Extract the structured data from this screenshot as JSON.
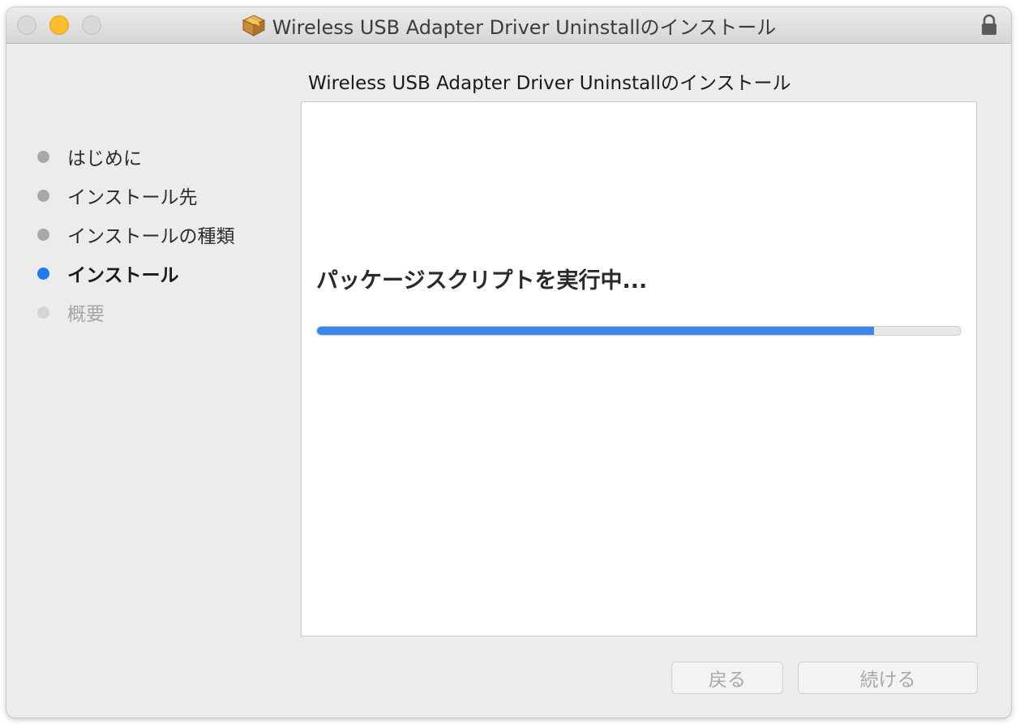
{
  "window": {
    "title": "Wireless USB Adapter Driver Uninstallのインストール"
  },
  "heading": "Wireless USB Adapter Driver Uninstallのインストール",
  "steps": [
    {
      "label": "はじめに",
      "state": "done"
    },
    {
      "label": "インストール先",
      "state": "done"
    },
    {
      "label": "インストールの種類",
      "state": "done"
    },
    {
      "label": "インストール",
      "state": "current"
    },
    {
      "label": "概要",
      "state": "todo"
    }
  ],
  "main": {
    "status": "パッケージスクリプトを実行中...",
    "progress": 0.865
  },
  "buttons": {
    "back": "戻る",
    "continue": "続ける"
  },
  "colors": {
    "accent": "#1f7cf0",
    "progress": "#3a87ea",
    "minimize": "#fdbc2e"
  },
  "icons": {
    "title": "package-icon",
    "lock": "lock-icon"
  }
}
